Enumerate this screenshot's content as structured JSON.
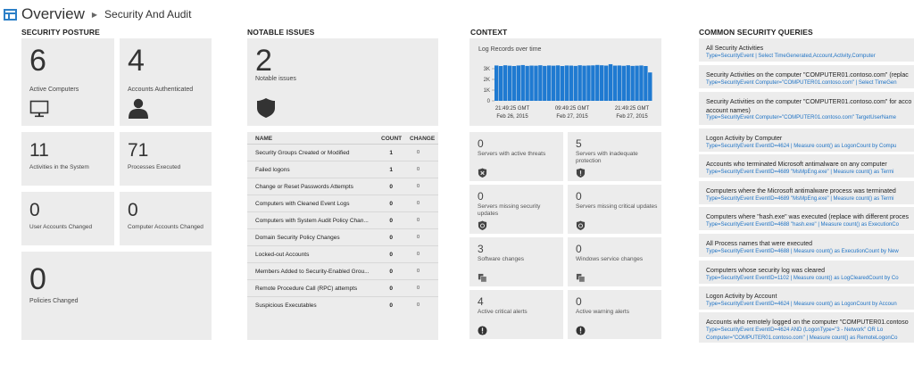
{
  "header": {
    "title": "Overview",
    "breadcrumb": "Security And Audit"
  },
  "sections": {
    "posture": "SECURITY POSTURE",
    "issues": "NOTABLE ISSUES",
    "context": "CONTEXT",
    "queries": "COMMON SECURITY QUERIES"
  },
  "posture": {
    "active_computers": {
      "value": "6",
      "label": "Active Computers"
    },
    "accounts_authenticated": {
      "value": "4",
      "label": "Accounts Authenticated"
    },
    "activities": {
      "value": "11",
      "label": "Activities in the System"
    },
    "processes": {
      "value": "71",
      "label": "Processes Executed"
    },
    "user_accounts": {
      "value": "0",
      "label": "User Accounts Changed"
    },
    "computer_accounts": {
      "value": "0",
      "label": "Computer Accounts Changed"
    },
    "policies": {
      "value": "0",
      "label": "Policies Changed"
    }
  },
  "issues": {
    "count": "2",
    "label": "Notable issues",
    "columns": {
      "name": "NAME",
      "count": "COUNT",
      "change": "CHANGE"
    },
    "rows": [
      {
        "name": "Security Groups Created or Modified",
        "count": "1",
        "change": "0"
      },
      {
        "name": "Failed logons",
        "count": "1",
        "change": "0"
      },
      {
        "name": "Change or Reset Passwords Attempts",
        "count": "0",
        "change": "0"
      },
      {
        "name": "Computers with Cleaned Event Logs",
        "count": "0",
        "change": "0"
      },
      {
        "name": "Computers with System Audit Policy Chan...",
        "count": "0",
        "change": "0"
      },
      {
        "name": "Domain Security Policy Changes",
        "count": "0",
        "change": "0"
      },
      {
        "name": "Locked-out Accounts",
        "count": "0",
        "change": "0"
      },
      {
        "name": "Members Added to Security-Enabled Grou...",
        "count": "0",
        "change": "0"
      },
      {
        "name": "Remote Procedure Call (RPC) attempts",
        "count": "0",
        "change": "0"
      },
      {
        "name": "Suspicious Executables",
        "count": "0",
        "change": "0"
      }
    ]
  },
  "context": {
    "chart_title": "Log Records over time",
    "chart_color": "#1f7ad1",
    "chart_data": {
      "type": "bar",
      "title": "Log Records over time",
      "yticks": [
        "3K",
        "2K",
        "1K",
        "0"
      ],
      "ylim": [
        0,
        3500
      ],
      "xticks": [
        {
          "time": "21:49:25 GMT",
          "date": "Feb 26, 2015"
        },
        {
          "time": "09:49:25 GMT",
          "date": "Feb 27, 2015"
        },
        {
          "time": "21:49:25 GMT",
          "date": "Feb 27, 2015"
        }
      ],
      "values": [
        3300,
        3250,
        3320,
        3280,
        3250,
        3300,
        3340,
        3260,
        3290,
        3280,
        3320,
        3260,
        3300,
        3280,
        3310,
        3250,
        3300,
        3290,
        3260,
        3320,
        3280,
        3300,
        3310,
        3350,
        3320,
        3290,
        3420,
        3290,
        3300,
        3270,
        3320,
        3260,
        3280,
        3300,
        3250,
        2650
      ]
    },
    "tiles": [
      {
        "value": "0",
        "label": "Servers with active threats",
        "icon": "shield-alert-icon"
      },
      {
        "value": "5",
        "label": "Servers with inadequate protection",
        "icon": "shield-warning-icon"
      },
      {
        "value": "0",
        "label": "Servers missing security updates",
        "icon": "shield-update-icon"
      },
      {
        "value": "0",
        "label": "Servers missing critical updates",
        "icon": "shield-critical-icon"
      },
      {
        "value": "3",
        "label": "Software changes",
        "icon": "software-icon"
      },
      {
        "value": "0",
        "label": "Windows service changes",
        "icon": "service-icon"
      },
      {
        "value": "4",
        "label": "Active critical alerts",
        "icon": "critical-alert-icon"
      },
      {
        "value": "0",
        "label": "Active warning alerts",
        "icon": "warning-alert-icon"
      }
    ]
  },
  "queries": [
    {
      "title": "All Security Activities",
      "lines": [
        "Type=SecurityEvent | Select TimeGenerated,Account,Activity,Computer"
      ]
    },
    {
      "title": "Security Activities on the computer \"COMPUTER01.contoso.com\" (replac",
      "lines": [
        "Type=SecurityEvent Computer=\"COMPUTER01.contoso.com\" | Select TimeGen"
      ]
    },
    {
      "title": "Security Activities on the computer \"COMPUTER01.contoso.com\" for acco",
      "title2": "account names)",
      "lines": [
        "Type=SecurityEvent Computer=\"COMPUTER01.contoso.com\" TargetUserName"
      ]
    },
    {
      "title": "Logon Activity by Computer",
      "lines": [
        "Type=SecurityEvent EventID=4624 | Measure count() as LogonCount by Compu"
      ]
    },
    {
      "title": "Accounts who terminated Microsoft antimalware on any computer",
      "lines": [
        "Type=SecurityEvent EventID=4689 \"MsMpEng.exe\" | Measure count() as Termi"
      ]
    },
    {
      "title": "Computers where the Microsoft antimalware process was terminated",
      "lines": [
        "Type=SecurityEvent EventID=4689 \"MsMpEng.exe\" | Measure count() as Termi"
      ]
    },
    {
      "title": "Computers where \"hash.exe\" was executed (replace with different proces",
      "lines": [
        "Type=SecurityEvent EventID=4688 \"hash.exe\" | Measure count() as ExecutionCo"
      ]
    },
    {
      "title": "All Process names that were executed",
      "lines": [
        "Type=SecurityEvent EventID=4688 | Measure count() as ExecutionCount by New"
      ]
    },
    {
      "title": "Computers whose security log was cleared",
      "lines": [
        "Type=SecurityEvent EventID=1102 | Measure count() as LogClearedCount by Co"
      ]
    },
    {
      "title": "Logon Activity by Account",
      "lines": [
        "Type=SecurityEvent EventID=4624 | Measure count() as LogonCount by Accoun"
      ]
    },
    {
      "title": "Accounts who remotely logged on the computer \"COMPUTER01.contoso",
      "lines": [
        "Type=SecurityEvent EventID=4624 AND (LogonType=\"3 - Network\" OR Lo",
        "Computer=\"COMPUTER01.contoso.com\" | Measure count() as RemoteLogonCo"
      ]
    }
  ]
}
